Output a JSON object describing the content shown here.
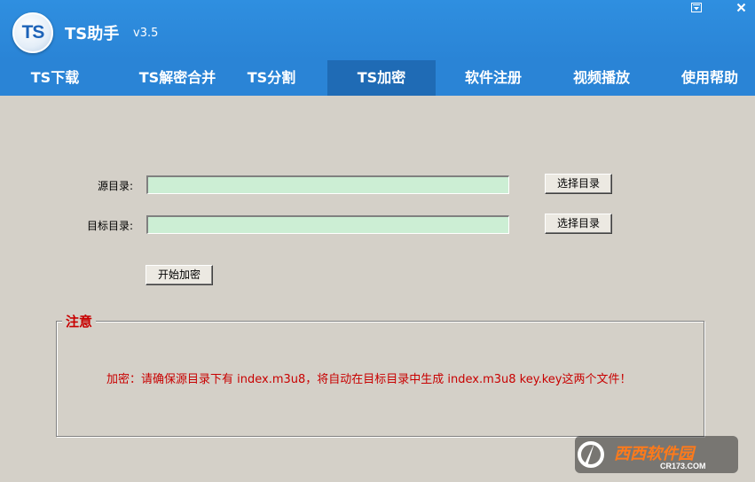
{
  "app": {
    "logo_text": "TS",
    "title": "TS助手",
    "version": "v3.5"
  },
  "window_controls": {
    "menu_icon": "dropdown-menu-icon",
    "close_icon": "close-icon"
  },
  "tabs": [
    {
      "label": "TS下载",
      "active": false
    },
    {
      "label": "TS解密合并",
      "active": false
    },
    {
      "label": "TS分割",
      "active": false
    },
    {
      "label": "TS加密",
      "active": true
    },
    {
      "label": "软件注册",
      "active": false
    },
    {
      "label": "视频播放",
      "active": false
    },
    {
      "label": "使用帮助",
      "active": false
    }
  ],
  "form": {
    "source_label": "源目录:",
    "source_value": "",
    "source_browse": "选择目录",
    "target_label": "目标目录:",
    "target_value": "",
    "target_browse": "选择目录",
    "start_button": "开始加密"
  },
  "notice": {
    "title": "注意",
    "text": "加密：请确保源目录下有 index.m3u8，将自动在目标目录中生成 index.m3u8 key.key这两个文件！"
  },
  "watermark": {
    "brand": "西西软件园",
    "site": "CR173.COM"
  },
  "colors": {
    "titlebar": "#2f8fe0",
    "active_tab": "#1f6bb5",
    "field_bg": "#cceed4",
    "notice_red": "#c80000",
    "window_bg": "#d4d0c8"
  }
}
